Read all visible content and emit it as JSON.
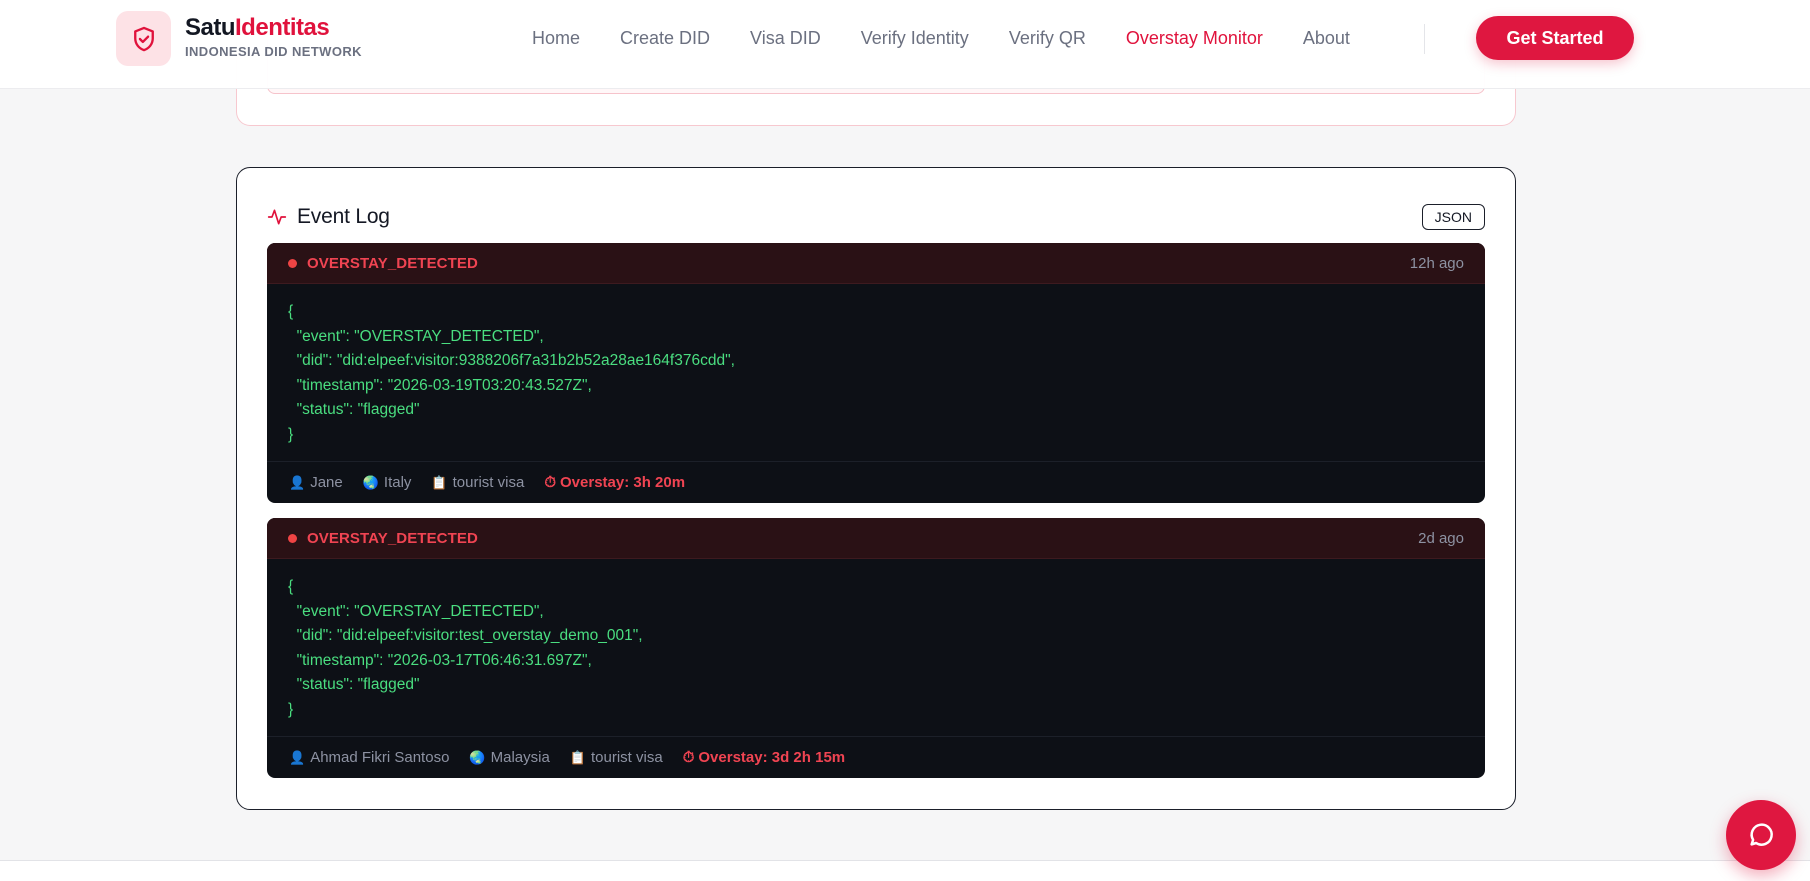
{
  "brand": {
    "name_part1": "Satu",
    "name_part2": "Identitas",
    "subtitle": "INDONESIA DID NETWORK",
    "logo_icon": "shield-check-icon"
  },
  "nav": {
    "links": [
      "Home",
      "Create DID",
      "Visa DID",
      "Verify Identity",
      "Verify QR",
      "Overstay Monitor",
      "About"
    ],
    "active": "Overstay Monitor",
    "cta_label": "Get Started"
  },
  "event_log": {
    "title": "Event Log",
    "title_icon": "activity-pulse-icon",
    "json_button": "JSON",
    "entries": [
      {
        "type": "OVERSTAY_DETECTED",
        "time_ago": "12h ago",
        "payload": "{\n  \"event\": \"OVERSTAY_DETECTED\",\n  \"did\": \"did:elpeef:visitor:9388206f7a31b2b52a28ae164f376cdd\",\n  \"timestamp\": \"2026-03-19T03:20:43.527Z\",\n  \"status\": \"flagged\"\n}",
        "name": "Jane",
        "country": "Italy",
        "visa_type": "tourist visa",
        "overstay": "Overstay: 3h 20m"
      },
      {
        "type": "OVERSTAY_DETECTED",
        "time_ago": "2d ago",
        "payload": "{\n  \"event\": \"OVERSTAY_DETECTED\",\n  \"did\": \"did:elpeef:visitor:test_overstay_demo_001\",\n  \"timestamp\": \"2026-03-17T06:46:31.697Z\",\n  \"status\": \"flagged\"\n}",
        "name": "Ahmad Fikri Santoso",
        "country": "Malaysia",
        "visa_type": "tourist visa",
        "overstay": "Overstay: 3d 2h 15m"
      }
    ]
  },
  "icons": {
    "person": "👤",
    "globe": "🌏",
    "document": "📋",
    "timer": "⏱"
  },
  "colors": {
    "accent": "#df1740",
    "alert_red": "#f04452",
    "json_green": "#4ade80",
    "log_bg": "#0d1016"
  }
}
